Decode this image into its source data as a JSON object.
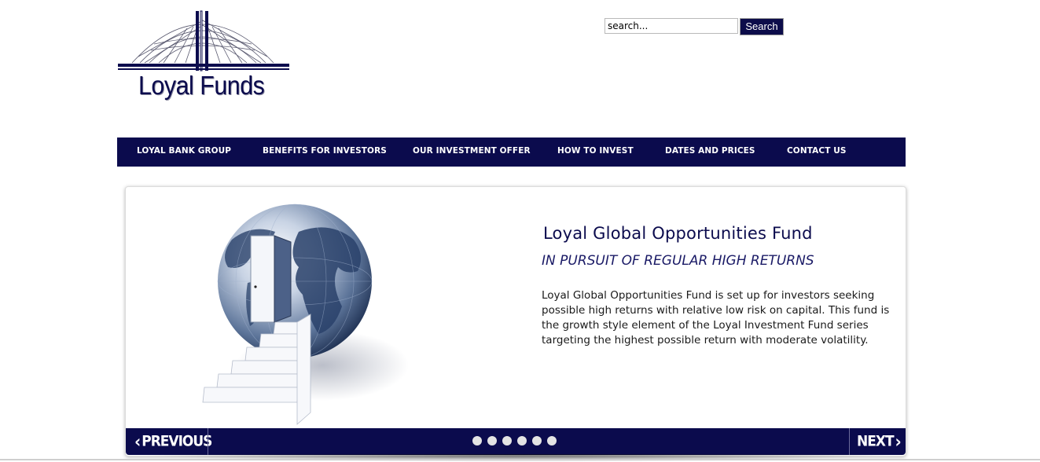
{
  "header": {
    "logo_text": "Loyal Funds",
    "search": {
      "value": "search...",
      "button_label": "Search"
    }
  },
  "nav": {
    "items": [
      {
        "label": "LOYAL BANK GROUP"
      },
      {
        "label": "BENEFITS FOR INVESTORS"
      },
      {
        "label": "OUR INVESTMENT OFFER"
      },
      {
        "label": "HOW TO INVEST"
      },
      {
        "label": "DATES AND PRICES"
      },
      {
        "label": "CONTACT US"
      }
    ]
  },
  "slider": {
    "title": "Loyal Global Opportunities Fund",
    "subtitle": "IN PURSUIT OF REGULAR HIGH RETURNS",
    "body": "Loyal Global Opportunities Fund is set up for investors seeking possible high returns with relative low risk on capital. This fund is the growth style element of the Loyal Investment Fund series targeting the highest possible return with moderate volatility.",
    "prev_label": "PREVIOUS",
    "next_label": "NEXT",
    "slide_count": 6
  },
  "colors": {
    "navy": "#0b0b4d",
    "white": "#ffffff"
  },
  "icons": {
    "prev": "chevron-left-icon",
    "next": "chevron-right-icon"
  }
}
